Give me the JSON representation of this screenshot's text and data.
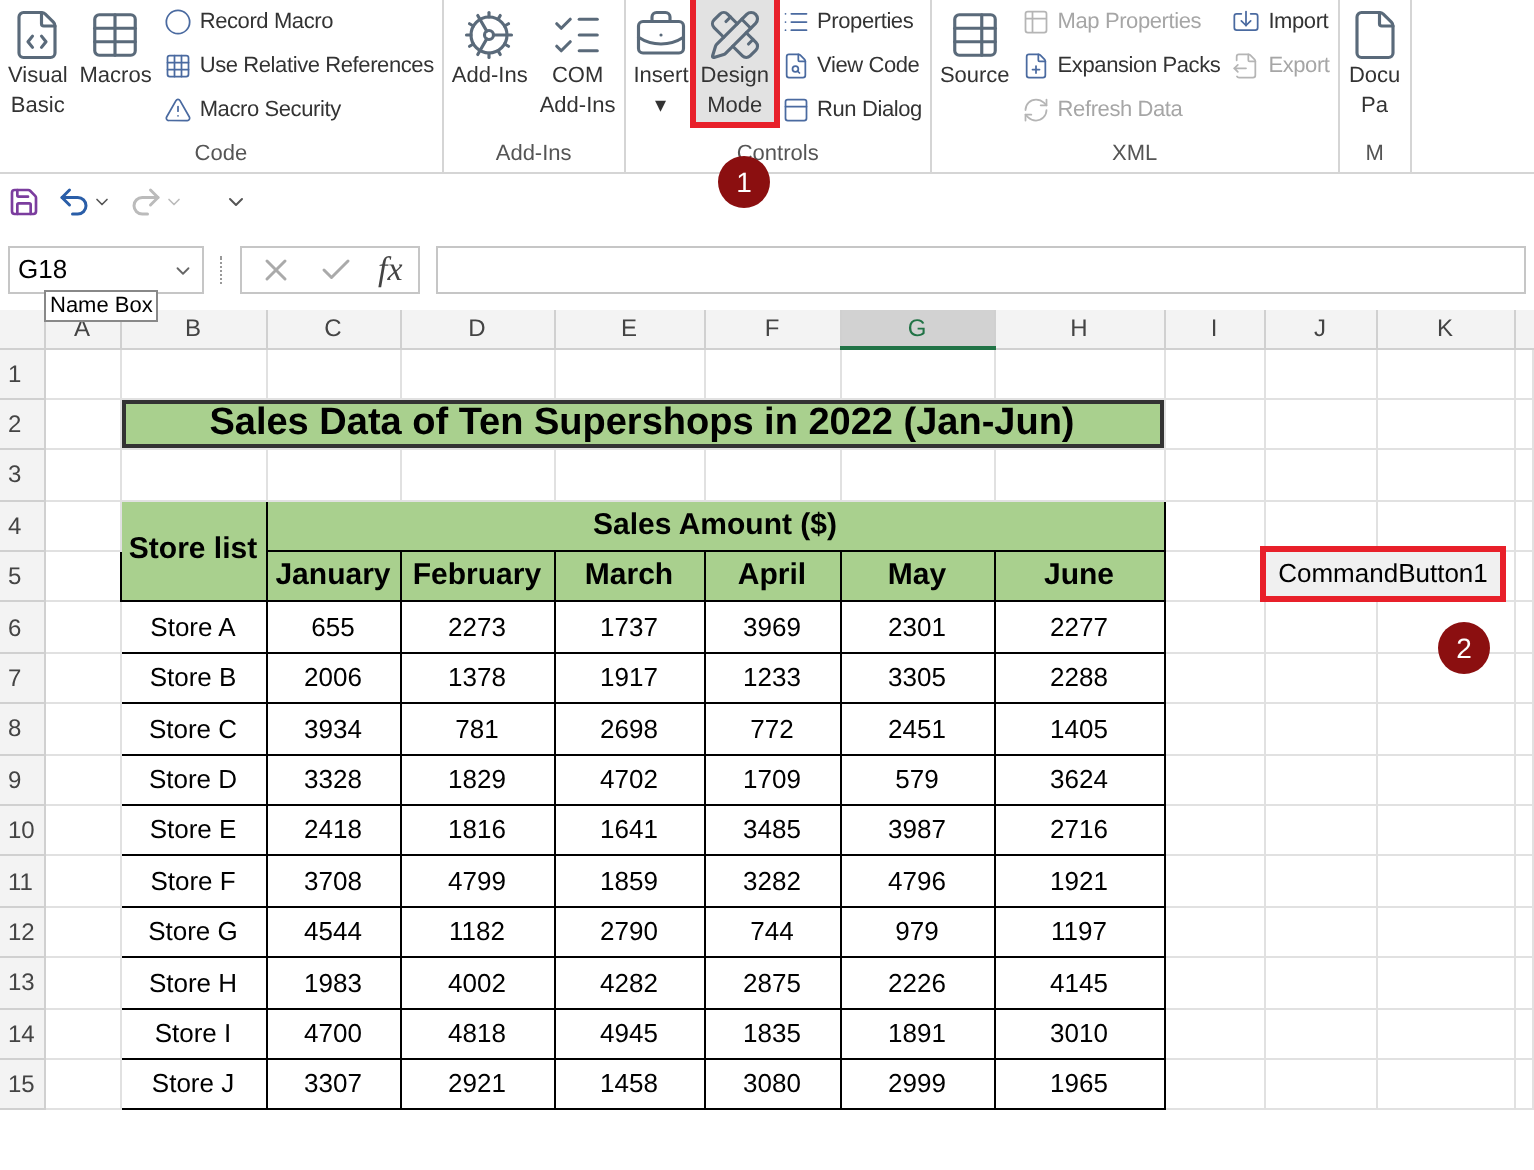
{
  "ribbon": {
    "groups": [
      {
        "label": "Code",
        "items": [
          {
            "kind": "large",
            "lines": [
              "Visual",
              "Basic"
            ],
            "disabled": false,
            "selected": false
          },
          {
            "kind": "large",
            "lines": [
              "Macros"
            ],
            "disabled": false,
            "selected": false
          },
          {
            "kind": "small",
            "lines": [
              "Record Macro"
            ],
            "disabled": false,
            "selected": false
          },
          {
            "kind": "small",
            "lines": [
              "Use Relative References"
            ],
            "disabled": false,
            "selected": false
          },
          {
            "kind": "small",
            "lines": [
              "Macro Security"
            ],
            "disabled": false,
            "selected": false
          }
        ]
      },
      {
        "label": "Add-Ins",
        "items": [
          {
            "kind": "large",
            "lines": [
              "Add-Ins"
            ],
            "disabled": false,
            "selected": false
          },
          {
            "kind": "large",
            "lines": [
              "COM",
              "Add-Ins"
            ],
            "disabled": false,
            "selected": false
          }
        ]
      },
      {
        "label": "Controls",
        "items": [
          {
            "kind": "large",
            "lines": [
              "Insert",
              "▾"
            ],
            "disabled": false,
            "selected": false
          },
          {
            "kind": "large",
            "lines": [
              "Design",
              "Mode"
            ],
            "disabled": false,
            "selected": true
          },
          {
            "kind": "small",
            "lines": [
              "Properties"
            ],
            "disabled": false,
            "selected": false
          },
          {
            "kind": "small",
            "lines": [
              "View Code"
            ],
            "disabled": false,
            "selected": false
          },
          {
            "kind": "small",
            "lines": [
              "Run Dialog"
            ],
            "disabled": false,
            "selected": false
          }
        ]
      },
      {
        "label": "XML",
        "items": [
          {
            "kind": "large",
            "lines": [
              "Source"
            ],
            "disabled": false,
            "selected": false
          },
          {
            "kind": "small",
            "lines": [
              "Map Properties"
            ],
            "disabled": true,
            "selected": false
          },
          {
            "kind": "small",
            "lines": [
              "Expansion Packs"
            ],
            "disabled": false,
            "selected": false
          },
          {
            "kind": "small",
            "lines": [
              "Refresh Data"
            ],
            "disabled": true,
            "selected": false
          },
          {
            "kind": "small",
            "lines": [
              "Import"
            ],
            "disabled": false,
            "selected": false
          },
          {
            "kind": "small",
            "lines": [
              "Export"
            ],
            "disabled": true,
            "selected": false
          }
        ]
      },
      {
        "label": "M",
        "items": [
          {
            "kind": "large",
            "lines": [
              "Docu",
              "Pa"
            ],
            "disabled": false,
            "selected": false
          }
        ]
      }
    ]
  },
  "quick_access": {
    "redo_disabled": true
  },
  "formula_bar": {
    "name_box": "G18",
    "fx": "fx",
    "tooltip": "Name Box"
  },
  "sheet": {
    "columns": [
      {
        "label": "A",
        "selected": false
      },
      {
        "label": "B",
        "selected": false
      },
      {
        "label": "C",
        "selected": false
      },
      {
        "label": "D",
        "selected": false
      },
      {
        "label": "E",
        "selected": false
      },
      {
        "label": "F",
        "selected": false
      },
      {
        "label": "G",
        "selected": true
      },
      {
        "label": "H",
        "selected": false
      },
      {
        "label": "I",
        "selected": false
      },
      {
        "label": "J",
        "selected": false
      },
      {
        "label": "K",
        "selected": false
      }
    ],
    "rows": [
      "1",
      "2",
      "3",
      "4",
      "5",
      "6",
      "7",
      "8",
      "9",
      "10",
      "11",
      "12",
      "13",
      "14",
      "15"
    ],
    "title": "Sales Data of Ten Supershops in 2022 (Jan-Jun)",
    "table": {
      "corner": "Store list",
      "group_heading": "Sales Amount ($)",
      "months": [
        "January",
        "February",
        "March",
        "April",
        "May",
        "June"
      ],
      "rows": [
        [
          "Store A",
          "655",
          "2273",
          "1737",
          "3969",
          "2301",
          "2277"
        ],
        [
          "Store B",
          "2006",
          "1378",
          "1917",
          "1233",
          "3305",
          "2288"
        ],
        [
          "Store C",
          "3934",
          "781",
          "2698",
          "772",
          "2451",
          "1405"
        ],
        [
          "Store D",
          "3328",
          "1829",
          "4702",
          "1709",
          "579",
          "3624"
        ],
        [
          "Store E",
          "2418",
          "1816",
          "1641",
          "3485",
          "3987",
          "2716"
        ],
        [
          "Store F",
          "3708",
          "4799",
          "1859",
          "3282",
          "4796",
          "1921"
        ],
        [
          "Store G",
          "4544",
          "1182",
          "2790",
          "744",
          "979",
          "1197"
        ],
        [
          "Store H",
          "1983",
          "4002",
          "4282",
          "2875",
          "2226",
          "4145"
        ],
        [
          "Store I",
          "4700",
          "4818",
          "4945",
          "1835",
          "1891",
          "3010"
        ],
        [
          "Store J",
          "3307",
          "2921",
          "1458",
          "3080",
          "2999",
          "1965"
        ]
      ]
    },
    "command_button": {
      "label": "CommandButton1",
      "highlighted": true
    }
  },
  "annotations": [
    "1",
    "2"
  ]
}
